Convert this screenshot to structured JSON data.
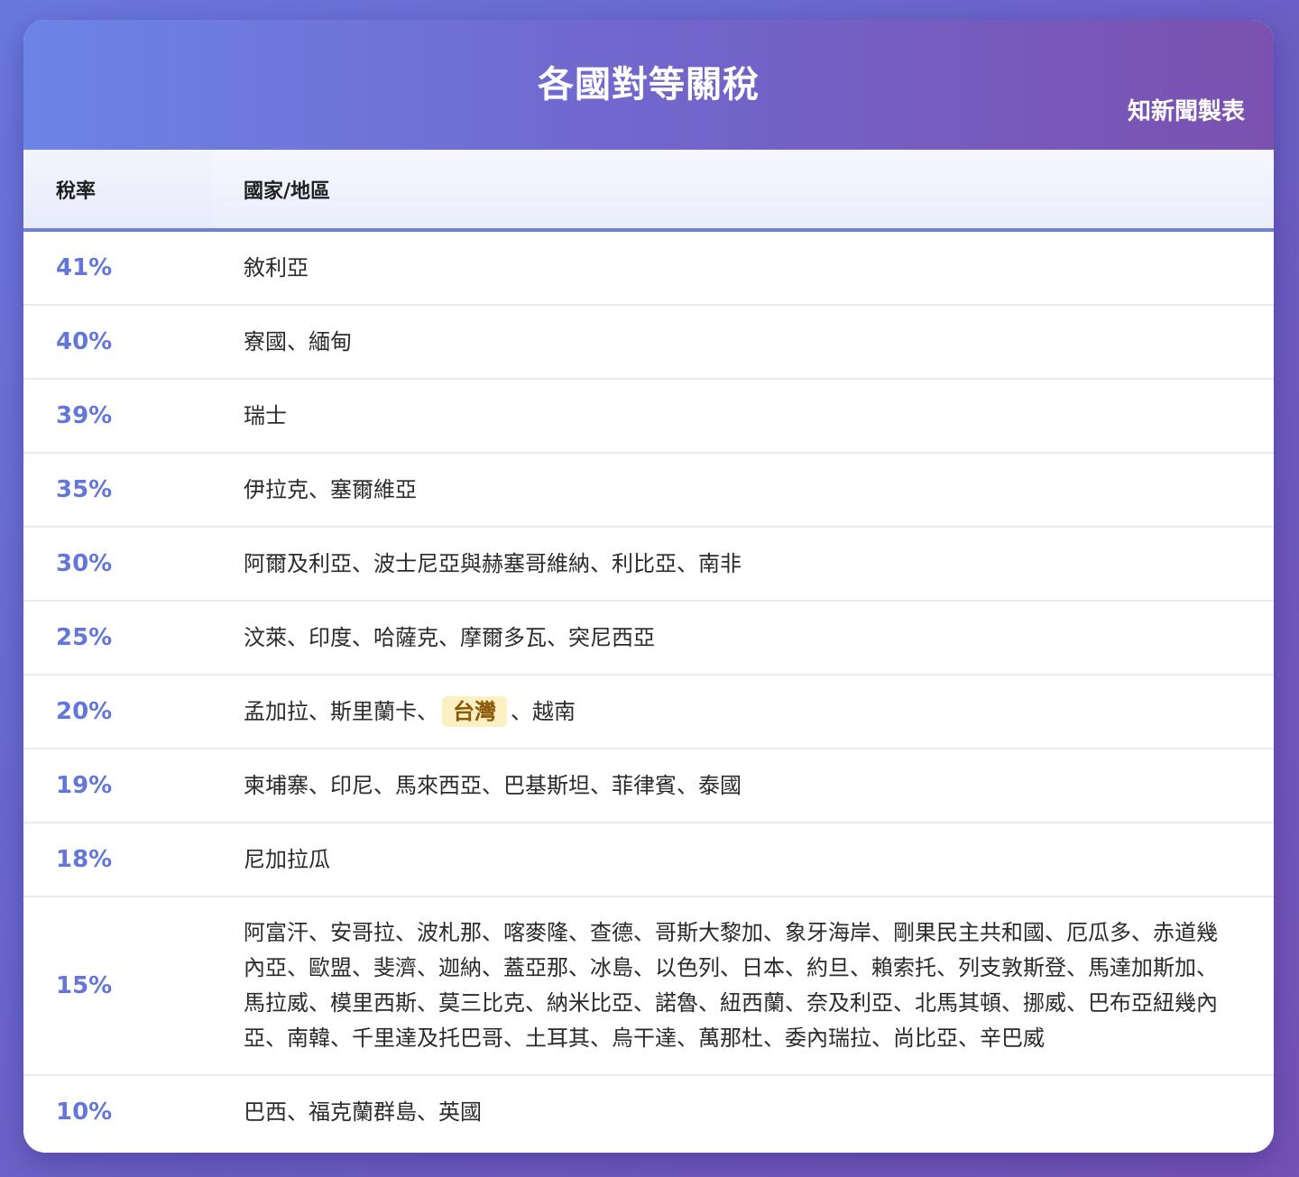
{
  "header": {
    "title": "各國對等關稅",
    "credit": "知新聞製表"
  },
  "columns": {
    "rate": "稅率",
    "countries": "國家/地區"
  },
  "rows": [
    {
      "rate": "41%",
      "countries": "敘利亞"
    },
    {
      "rate": "40%",
      "countries": "寮國、緬甸"
    },
    {
      "rate": "39%",
      "countries": "瑞士"
    },
    {
      "rate": "35%",
      "countries": "伊拉克、塞爾維亞"
    },
    {
      "rate": "30%",
      "countries": "阿爾及利亞、波士尼亞與赫塞哥維納、利比亞、南非"
    },
    {
      "rate": "25%",
      "countries": "汶萊、印度、哈薩克、摩爾多瓦、突尼西亞"
    },
    {
      "rate": "20%",
      "countries_before": "孟加拉、斯里蘭卡、",
      "highlight": "台灣",
      "countries_after": "、越南"
    },
    {
      "rate": "19%",
      "countries": "柬埔寨、印尼、馬來西亞、巴基斯坦、菲律賓、泰國"
    },
    {
      "rate": "18%",
      "countries": "尼加拉瓜"
    },
    {
      "rate": "15%",
      "countries": "阿富汗、安哥拉、波札那、喀麥隆、查德、哥斯大黎加、象牙海岸、剛果民主共和國、厄瓜多、赤道幾內亞、歐盟、斐濟、迦納、蓋亞那、冰島、以色列、日本、約旦、賴索托、列支敦斯登、馬達加斯加、馬拉威、模里西斯、莫三比克、納米比亞、諾魯、紐西蘭、奈及利亞、北馬其頓、挪威、巴布亞紐幾內亞、南韓、千里達及托巴哥、土耳其、烏干達、萬那杜、委內瑞拉、尚比亞、辛巴威"
    },
    {
      "rate": "10%",
      "countries": "巴西、福克蘭群島、英國"
    }
  ],
  "colors": {
    "rate_text": "#6377d8",
    "header_gradient_start": "#6c84e6",
    "header_gradient_end": "#7b51b0",
    "highlight_bg": "#fcefc2",
    "highlight_text": "#8a5a0a"
  }
}
